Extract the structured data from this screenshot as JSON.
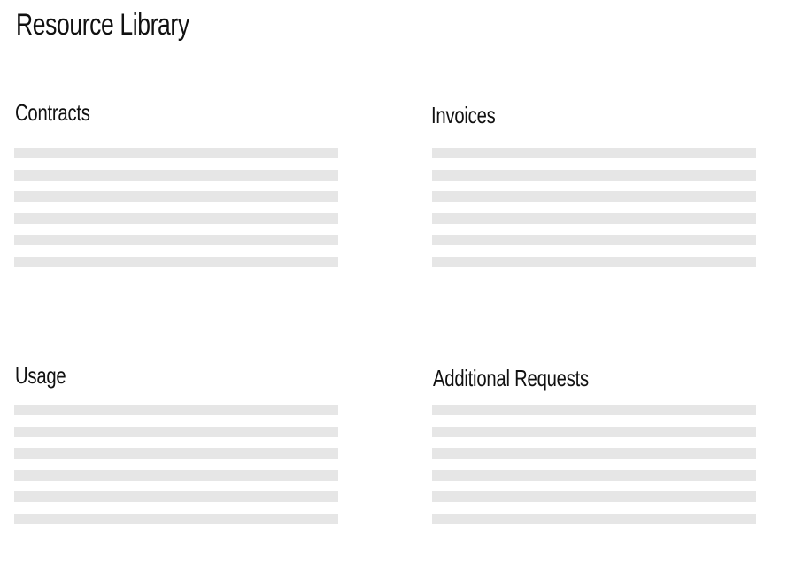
{
  "page": {
    "title": "Resource Library"
  },
  "sections": [
    {
      "id": "contracts",
      "title": "Contracts",
      "placeholder_lines": 6
    },
    {
      "id": "invoices",
      "title": "Invoices",
      "placeholder_lines": 6
    },
    {
      "id": "usage",
      "title": "Usage",
      "placeholder_lines": 6
    },
    {
      "id": "additional-requests",
      "title": "Additional Requests",
      "placeholder_lines": 6
    }
  ],
  "colors": {
    "text": "#111111",
    "placeholder": "#e6e6e6",
    "background": "#ffffff"
  }
}
